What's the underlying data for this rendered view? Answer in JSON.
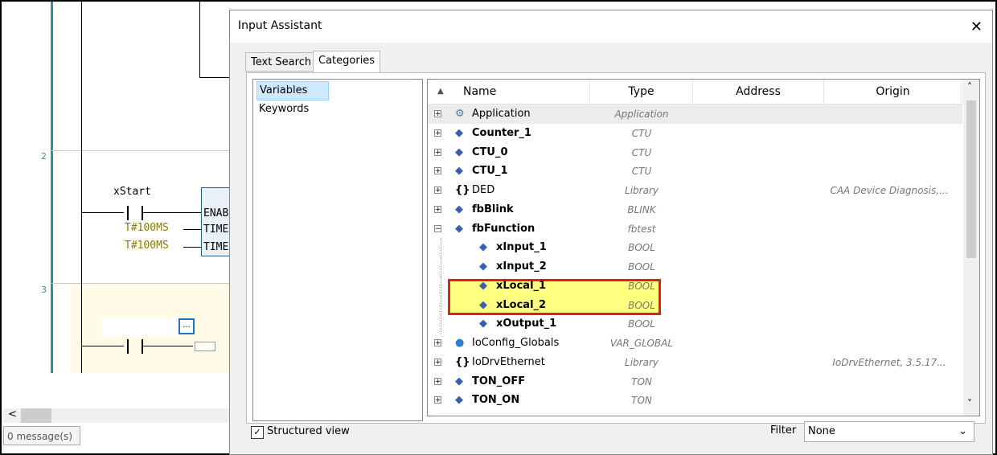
{
  "ladder": {
    "row_numbers": [
      "2",
      "3"
    ],
    "var_name": "xStart",
    "const1": "T#100MS",
    "const2": "T#100MS",
    "fb_pin1": "ENAB",
    "fb_pin2": "TIME",
    "fb_pin3": "TIME",
    "ellipsis_btn": "...",
    "status_text": "0 message(s)",
    "scroll_left": "<"
  },
  "dialog": {
    "title": "Input Assistant",
    "close_icon": "✕",
    "tabs": [
      {
        "label": "Text Search",
        "active": false
      },
      {
        "label": "Categories",
        "active": true
      }
    ],
    "categories": [
      "Variables",
      "Keywords"
    ],
    "selected_category": "Variables",
    "columns": [
      "Name",
      "Type",
      "Address",
      "Origin"
    ],
    "sort_indicator": "▲",
    "rows": [
      {
        "name": "Application",
        "type": "Application",
        "origin": "",
        "bold": false,
        "icon": "gear-icon",
        "level": 0,
        "expander": "+"
      },
      {
        "name": "Counter_1",
        "type": "CTU",
        "origin": "",
        "bold": true,
        "icon": "diamond-icon",
        "level": 0,
        "expander": "+"
      },
      {
        "name": "CTU_0",
        "type": "CTU",
        "origin": "",
        "bold": true,
        "icon": "diamond-icon",
        "level": 0,
        "expander": "+"
      },
      {
        "name": "CTU_1",
        "type": "CTU",
        "origin": "",
        "bold": true,
        "icon": "diamond-icon",
        "level": 0,
        "expander": "+"
      },
      {
        "name": "DED",
        "type": "Library",
        "origin": "CAA Device Diagnosis,...",
        "bold": false,
        "icon": "braces-icon",
        "level": 0,
        "expander": "+"
      },
      {
        "name": "fbBlink",
        "type": "BLINK",
        "origin": "",
        "bold": true,
        "icon": "diamond-icon",
        "level": 0,
        "expander": "+"
      },
      {
        "name": "fbFunction",
        "type": "fbtest",
        "origin": "",
        "bold": true,
        "icon": "diamond-icon",
        "level": 0,
        "expander": "−"
      },
      {
        "name": "xInput_1",
        "type": "BOOL",
        "origin": "",
        "bold": true,
        "icon": "input-var-icon",
        "level": 1,
        "expander": ""
      },
      {
        "name": "xInput_2",
        "type": "BOOL",
        "origin": "",
        "bold": true,
        "icon": "input-var-icon",
        "level": 1,
        "expander": ""
      },
      {
        "name": "xLocal_1",
        "type": "BOOL",
        "origin": "",
        "bold": true,
        "icon": "local-var-icon",
        "level": 1,
        "expander": ""
      },
      {
        "name": "xLocal_2",
        "type": "BOOL",
        "origin": "",
        "bold": true,
        "icon": "local-var-icon",
        "level": 1,
        "expander": ""
      },
      {
        "name": "xOutput_1",
        "type": "BOOL",
        "origin": "",
        "bold": true,
        "icon": "output-var-icon",
        "level": 1,
        "expander": ""
      },
      {
        "name": "IoConfig_Globals",
        "type": "VAR_GLOBAL",
        "origin": "",
        "bold": false,
        "icon": "globe-icon",
        "level": 0,
        "expander": "+"
      },
      {
        "name": "IoDrvEthernet",
        "type": "Library",
        "origin": "IoDrvEthernet, 3.5.17...",
        "bold": false,
        "icon": "braces-icon",
        "level": 0,
        "expander": "+"
      },
      {
        "name": "TON_OFF",
        "type": "TON",
        "origin": "",
        "bold": true,
        "icon": "diamond-icon",
        "level": 0,
        "expander": "+"
      },
      {
        "name": "TON_ON",
        "type": "TON",
        "origin": "",
        "bold": true,
        "icon": "diamond-icon",
        "level": 0,
        "expander": "+"
      }
    ],
    "structured_view_label": "Structured view",
    "structured_view_checked": "✓",
    "filter_label": "Filter",
    "filter_value": "None",
    "scroll_up": "˄",
    "scroll_down": "˅",
    "chevron": "⌄"
  }
}
